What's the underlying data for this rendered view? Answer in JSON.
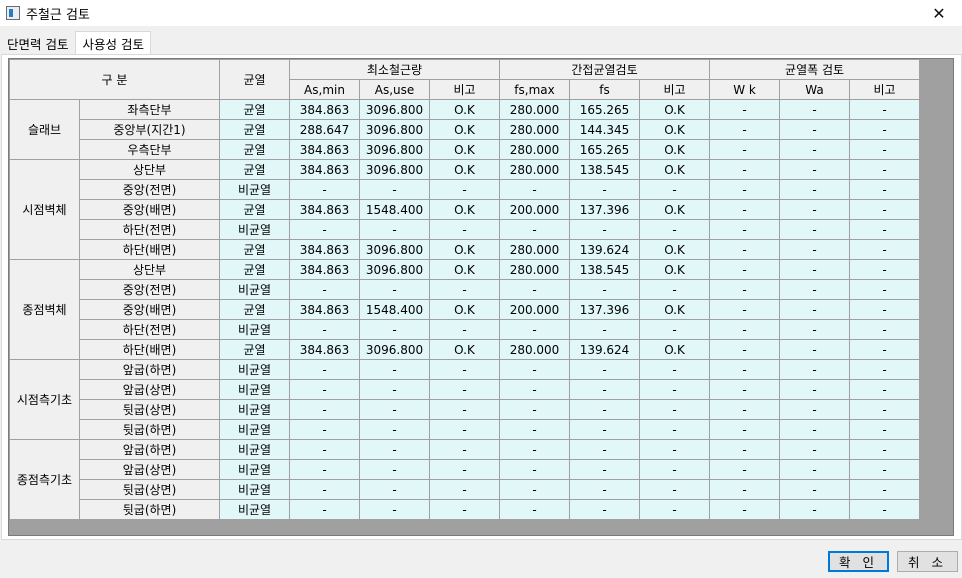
{
  "window": {
    "title": "주철근 검토",
    "close_glyph": "✕"
  },
  "tabs": [
    {
      "label": "단면력 검토",
      "active": false
    },
    {
      "label": "사용성 검토",
      "active": true
    }
  ],
  "table": {
    "header": {
      "division": "구 분",
      "crack": "균열",
      "groups": [
        "최소철근량",
        "간접균열검토",
        "균열폭 검토"
      ],
      "sub": [
        "As,min",
        "As,use",
        "비고",
        "fs,max",
        "fs",
        "비고",
        "W k",
        "Wa",
        "비고"
      ]
    },
    "groups": [
      {
        "name": "슬래브",
        "rows": [
          {
            "label": "좌측단부",
            "crack": "균열",
            "vals": [
              "384.863",
              "3096.800",
              "O.K",
              "280.000",
              "165.265",
              "O.K",
              "-",
              "-",
              "-"
            ]
          },
          {
            "label": "중앙부(지간1)",
            "crack": "균열",
            "vals": [
              "288.647",
              "3096.800",
              "O.K",
              "280.000",
              "144.345",
              "O.K",
              "-",
              "-",
              "-"
            ]
          },
          {
            "label": "우측단부",
            "crack": "균열",
            "vals": [
              "384.863",
              "3096.800",
              "O.K",
              "280.000",
              "165.265",
              "O.K",
              "-",
              "-",
              "-"
            ]
          }
        ]
      },
      {
        "name": "시점벽체",
        "rows": [
          {
            "label": "상단부",
            "crack": "균열",
            "vals": [
              "384.863",
              "3096.800",
              "O.K",
              "280.000",
              "138.545",
              "O.K",
              "-",
              "-",
              "-"
            ]
          },
          {
            "label": "중앙(전면)",
            "crack": "비균열",
            "vals": [
              "-",
              "-",
              "-",
              "-",
              "-",
              "-",
              "-",
              "-",
              "-"
            ]
          },
          {
            "label": "중앙(배면)",
            "crack": "균열",
            "vals": [
              "384.863",
              "1548.400",
              "O.K",
              "200.000",
              "137.396",
              "O.K",
              "-",
              "-",
              "-"
            ]
          },
          {
            "label": "하단(전면)",
            "crack": "비균열",
            "vals": [
              "-",
              "-",
              "-",
              "-",
              "-",
              "-",
              "-",
              "-",
              "-"
            ]
          },
          {
            "label": "하단(배면)",
            "crack": "균열",
            "vals": [
              "384.863",
              "3096.800",
              "O.K",
              "280.000",
              "139.624",
              "O.K",
              "-",
              "-",
              "-"
            ]
          }
        ]
      },
      {
        "name": "종점벽체",
        "rows": [
          {
            "label": "상단부",
            "crack": "균열",
            "vals": [
              "384.863",
              "3096.800",
              "O.K",
              "280.000",
              "138.545",
              "O.K",
              "-",
              "-",
              "-"
            ]
          },
          {
            "label": "중앙(전면)",
            "crack": "비균열",
            "vals": [
              "-",
              "-",
              "-",
              "-",
              "-",
              "-",
              "-",
              "-",
              "-"
            ]
          },
          {
            "label": "중앙(배면)",
            "crack": "균열",
            "vals": [
              "384.863",
              "1548.400",
              "O.K",
              "200.000",
              "137.396",
              "O.K",
              "-",
              "-",
              "-"
            ]
          },
          {
            "label": "하단(전면)",
            "crack": "비균열",
            "vals": [
              "-",
              "-",
              "-",
              "-",
              "-",
              "-",
              "-",
              "-",
              "-"
            ]
          },
          {
            "label": "하단(배면)",
            "crack": "균열",
            "vals": [
              "384.863",
              "3096.800",
              "O.K",
              "280.000",
              "139.624",
              "O.K",
              "-",
              "-",
              "-"
            ]
          }
        ]
      },
      {
        "name": "시점측기초",
        "rows": [
          {
            "label": "앞굽(하면)",
            "crack": "비균열",
            "vals": [
              "-",
              "-",
              "-",
              "-",
              "-",
              "-",
              "-",
              "-",
              "-"
            ]
          },
          {
            "label": "앞굽(상면)",
            "crack": "비균열",
            "vals": [
              "-",
              "-",
              "-",
              "-",
              "-",
              "-",
              "-",
              "-",
              "-"
            ]
          },
          {
            "label": "뒷굽(상면)",
            "crack": "비균열",
            "vals": [
              "-",
              "-",
              "-",
              "-",
              "-",
              "-",
              "-",
              "-",
              "-"
            ]
          },
          {
            "label": "뒷굽(하면)",
            "crack": "비균열",
            "vals": [
              "-",
              "-",
              "-",
              "-",
              "-",
              "-",
              "-",
              "-",
              "-"
            ]
          }
        ]
      },
      {
        "name": "종점측기초",
        "rows": [
          {
            "label": "앞굽(하면)",
            "crack": "비균열",
            "vals": [
              "-",
              "-",
              "-",
              "-",
              "-",
              "-",
              "-",
              "-",
              "-"
            ]
          },
          {
            "label": "앞굽(상면)",
            "crack": "비균열",
            "vals": [
              "-",
              "-",
              "-",
              "-",
              "-",
              "-",
              "-",
              "-",
              "-"
            ]
          },
          {
            "label": "뒷굽(상면)",
            "crack": "비균열",
            "vals": [
              "-",
              "-",
              "-",
              "-",
              "-",
              "-",
              "-",
              "-",
              "-"
            ]
          },
          {
            "label": "뒷굽(하면)",
            "crack": "비균열",
            "vals": [
              "-",
              "-",
              "-",
              "-",
              "-",
              "-",
              "-",
              "-",
              "-"
            ]
          }
        ]
      }
    ]
  },
  "buttons": {
    "ok": "확 인",
    "cancel": "취 소"
  },
  "colors": {
    "cell_bg": "#e2f8f8",
    "header_bg": "#f0f0f0",
    "grid_bg": "#a0a0a0"
  }
}
